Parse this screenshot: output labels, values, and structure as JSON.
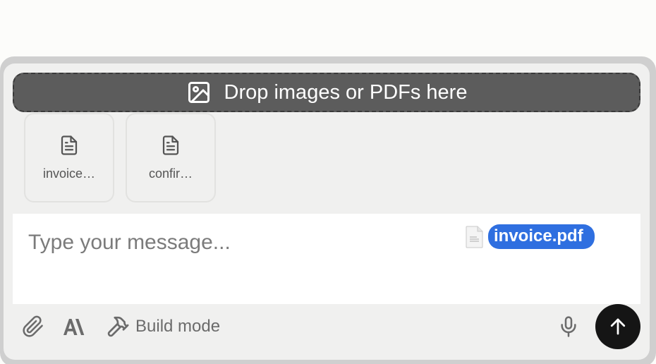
{
  "dropzone": {
    "label": "Drop images or PDFs here",
    "icon": "image-icon"
  },
  "attachments": [
    {
      "name": "invoice…",
      "icon": "document-icon"
    },
    {
      "name": "confir…",
      "icon": "document-icon"
    }
  ],
  "input": {
    "placeholder": "Type your message...",
    "value": ""
  },
  "drag_ghost": {
    "file_name": "invoice.pdf",
    "icon": "file-icon"
  },
  "toolbar": {
    "attach_icon": "paperclip-icon",
    "model_icon": "anthropic-logo-icon",
    "build_mode_label": "Build mode",
    "build_mode_icon": "hammer-icon",
    "mic_icon": "microphone-icon",
    "send_icon": "arrow-up-icon"
  },
  "colors": {
    "dropzone_bg": "#5c5c5c",
    "drag_pill": "#2f6fe0",
    "send_button": "#151515",
    "composer_bg": "#f0f0ef"
  }
}
